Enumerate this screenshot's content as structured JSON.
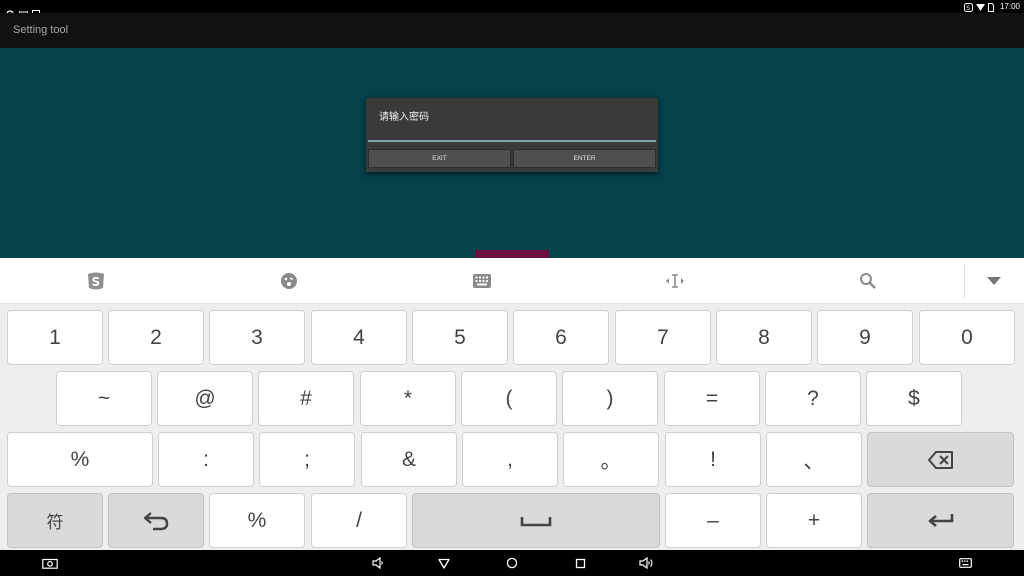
{
  "status_bar": {
    "time": "17:00",
    "left_icons": [
      "browser-e-icon",
      "cast-icon",
      "image-icon"
    ],
    "right_icons": [
      "sogou-icon",
      "wifi-icon",
      "sim-icon"
    ]
  },
  "app_bar": {
    "title": "Setting tool"
  },
  "dialog": {
    "title": "请输入密码",
    "input_value": "",
    "exit_label": "EXIT",
    "enter_label": "ENTER"
  },
  "keyboard_toolbar": {
    "items": [
      "sogou-logo-icon",
      "emoji-icon",
      "keyboard-icon",
      "cursor-move-icon",
      "search-icon",
      "collapse-keyboard-icon"
    ]
  },
  "keyboard": {
    "row1": [
      "1",
      "2",
      "3",
      "4",
      "5",
      "6",
      "7",
      "8",
      "9",
      "0"
    ],
    "row2": [
      "~",
      "@",
      "#",
      "*",
      "(",
      ")",
      "=",
      "?",
      "$"
    ],
    "row3": [
      "%",
      ":",
      ";",
      "&",
      ",",
      "。",
      "!",
      "、"
    ],
    "row4": {
      "symbol_key": "符",
      "percent": "%",
      "slash": "/",
      "minus": "–",
      "plus": "+"
    },
    "icon_keys": [
      "backspace-icon",
      "return-icon",
      "space-icon",
      "enter-icon"
    ]
  },
  "nav_bar": {
    "icons": [
      "screenshot-icon",
      "volume-down-icon",
      "back-icon",
      "home-icon",
      "recents-icon",
      "volume-up-icon",
      "keyboard-switch-icon"
    ]
  },
  "colors": {
    "content_bg": "#05424c",
    "dialog_bg": "#3a3a3a",
    "accent_strip": "#6b1040"
  }
}
